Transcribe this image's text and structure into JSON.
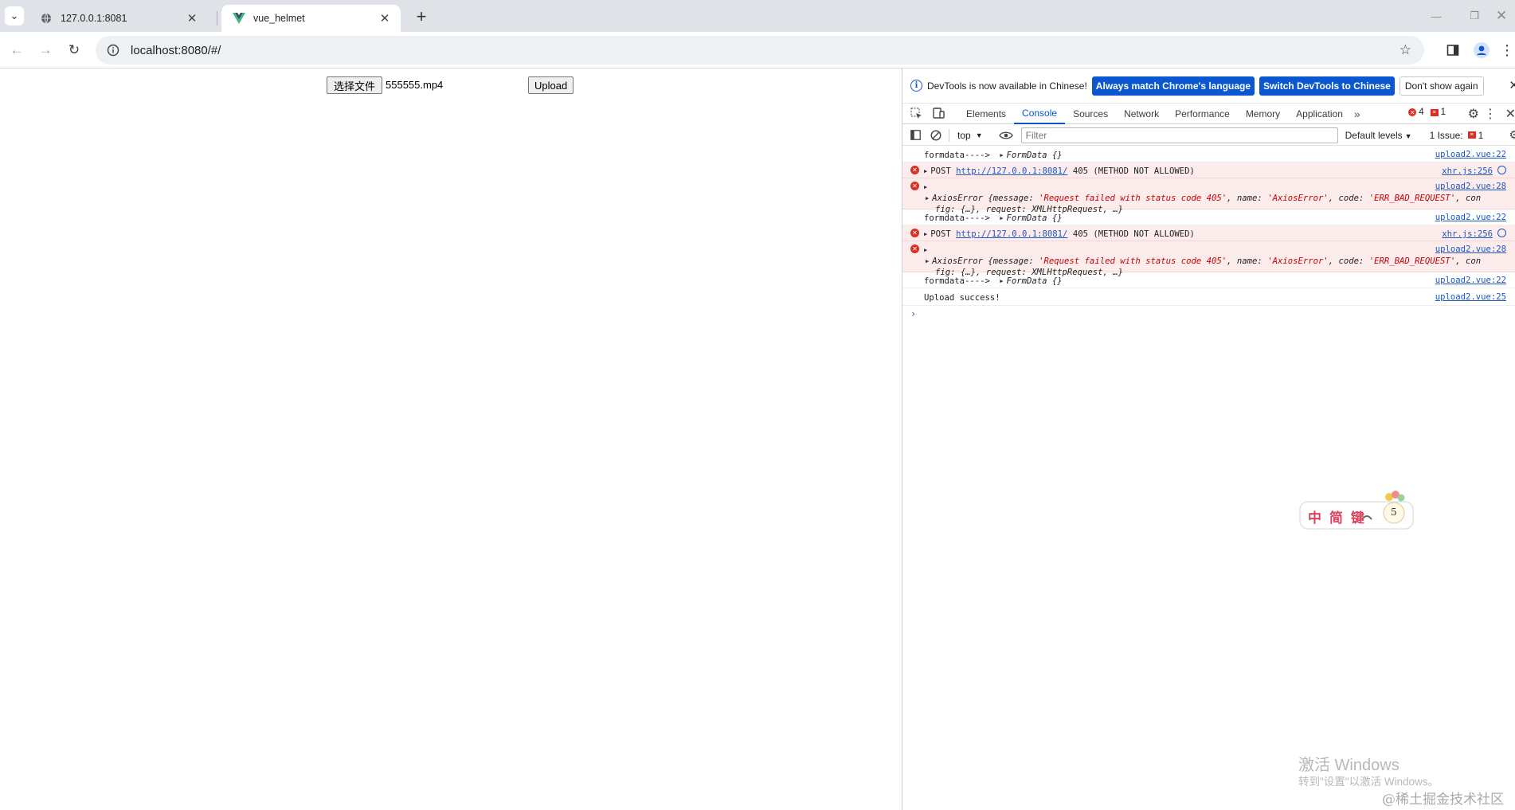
{
  "browser": {
    "tabs": [
      {
        "title": "127.0.0.1:8081",
        "active": false
      },
      {
        "title": "vue_helmet",
        "active": true
      }
    ],
    "url": "localhost:8080/#/"
  },
  "page": {
    "choose_file_label": "选择文件",
    "file_name": "555555.mp4",
    "upload_label": "Upload"
  },
  "devtools": {
    "infobar": {
      "message": "DevTools is now available in Chinese!",
      "match_language_label": "Always match Chrome's language",
      "switch_label": "Switch DevTools to Chinese",
      "dismiss_label": "Don't show again"
    },
    "tabs": [
      "Elements",
      "Console",
      "Sources",
      "Network",
      "Performance",
      "Memory",
      "Application"
    ],
    "active_tab": "Console",
    "error_count": "4",
    "issue_count_badge": "1",
    "console_bar": {
      "context": "top",
      "filter_placeholder": "Filter",
      "levels": "Default levels",
      "issues_label": "1 Issue:",
      "issues_count": "1"
    },
    "logs": {
      "l1": {
        "prefix": "formdata---->",
        "obj": "FormData {}",
        "src": "upload2.vue:22"
      },
      "l2": {
        "method": "POST",
        "url": "http://127.0.0.1:8081/",
        "status": "405 (METHOD NOT ALLOWED)",
        "src": "xhr.js:256"
      },
      "l3": {
        "src": "upload2.vue:28",
        "line1a": "AxiosError {message: ",
        "msg": "'Request failed with status code 405'",
        "line1b": ", name: ",
        "name": "'AxiosError'",
        "line1c": ", code: ",
        "code": "'ERR_BAD_REQUEST'",
        "line1d": ", con",
        "line2": "fig: {…}, request: XMLHttpRequest, …}"
      },
      "l4": {
        "prefix": "formdata---->",
        "obj": "FormData {}",
        "src": "upload2.vue:22"
      },
      "l5": {
        "method": "POST",
        "url": "http://127.0.0.1:8081/",
        "status": "405 (METHOD NOT ALLOWED)",
        "src": "xhr.js:256"
      },
      "l6": {
        "src": "upload2.vue:28",
        "line1a": "AxiosError {message: ",
        "msg": "'Request failed with status code 405'",
        "line1b": ", name: ",
        "name": "'AxiosError'",
        "line1c": ", code: ",
        "code": "'ERR_BAD_REQUEST'",
        "line1d": ", con",
        "line2": "fig: {…}, request: XMLHttpRequest, …}"
      },
      "l7": {
        "prefix": "formdata---->",
        "obj": "FormData {}",
        "src": "upload2.vue:22"
      },
      "l8": {
        "text": "Upload success!",
        "src": "upload2.vue:25"
      }
    }
  },
  "overlay": {
    "sticker_text": "中 简 键",
    "sticker_number": "5",
    "activate_title": "激活 Windows",
    "activate_sub": "转到\"设置\"以激活 Windows。",
    "site_watermark": "@稀土掘金技术社区"
  }
}
